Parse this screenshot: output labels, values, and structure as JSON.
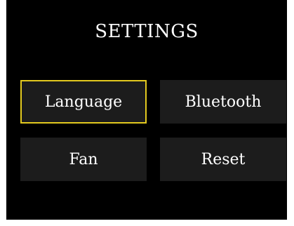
{
  "screen": {
    "title": "SETTINGS",
    "accent_color": "#e3c91f",
    "background_color": "#000000",
    "tile_color": "#1c1c1c",
    "menu": [
      {
        "label": "Language",
        "selected": true
      },
      {
        "label": "Bluetooth",
        "selected": false
      },
      {
        "label": "Fan",
        "selected": false
      },
      {
        "label": "Reset",
        "selected": false
      }
    ]
  }
}
